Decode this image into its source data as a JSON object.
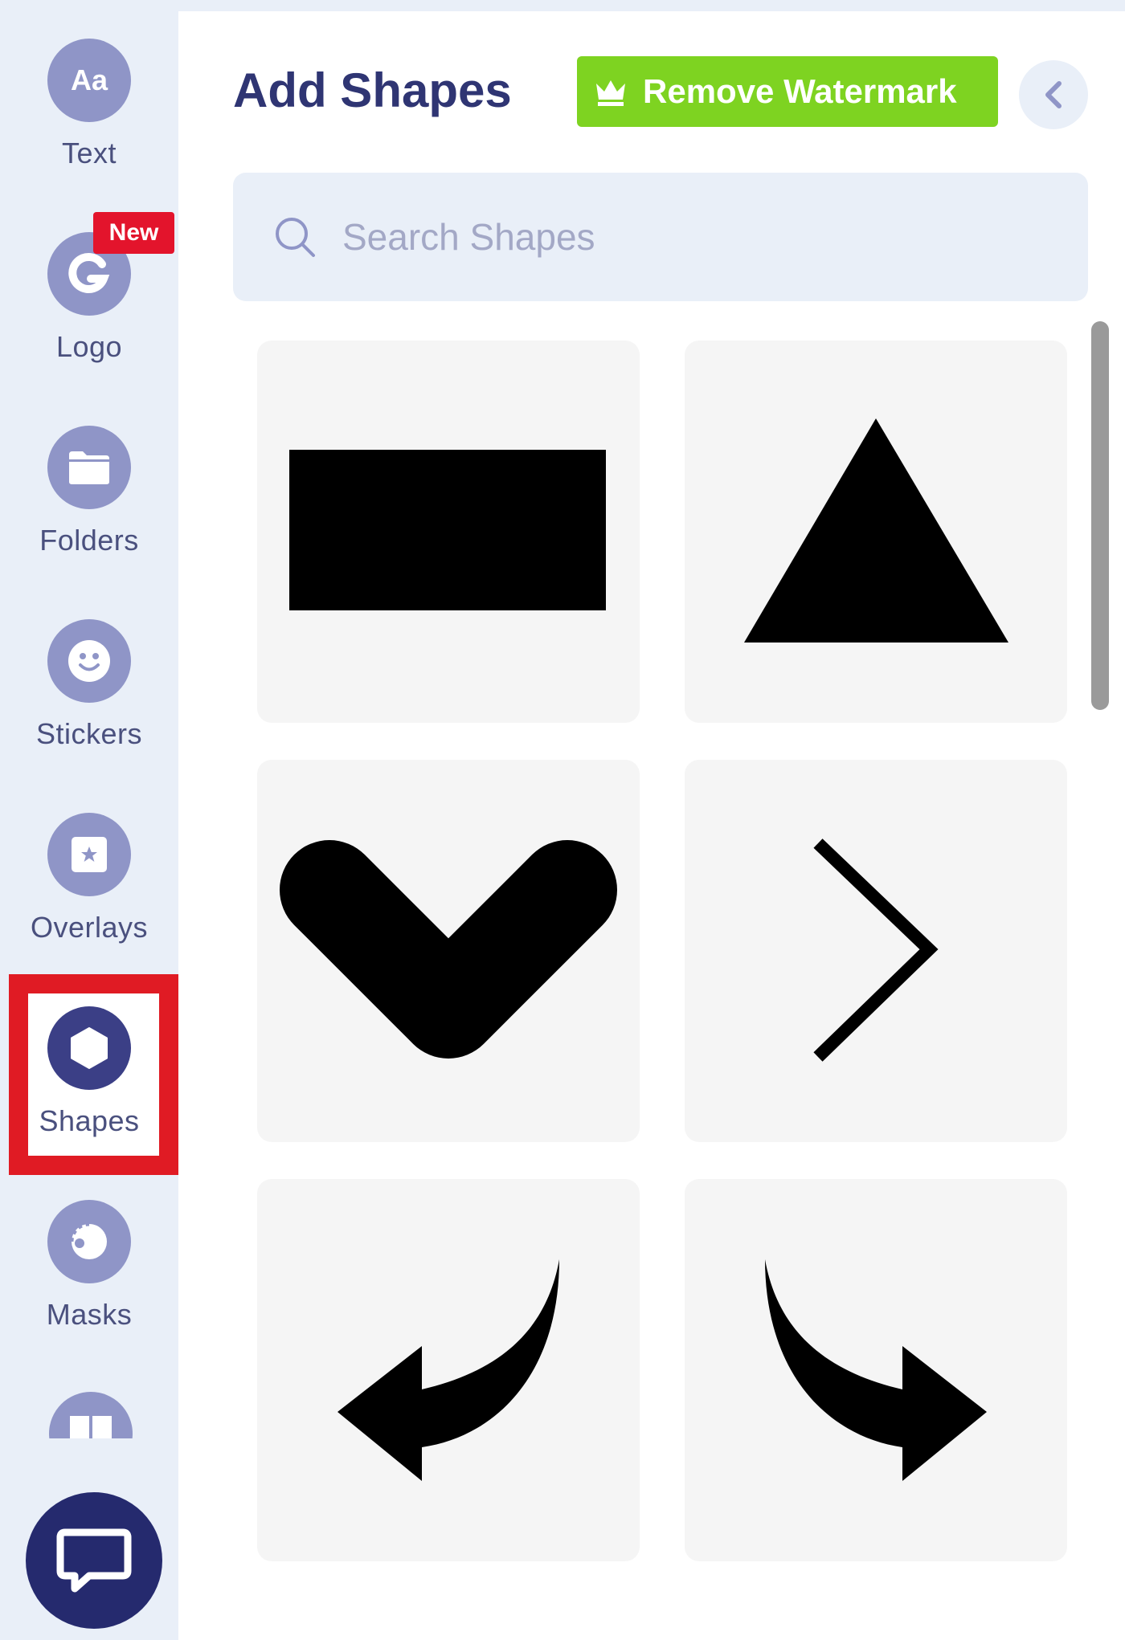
{
  "sidebar": {
    "items": [
      {
        "label": "Text",
        "icon": "text-aa-icon"
      },
      {
        "label": "Logo",
        "icon": "logo-icon",
        "badge": "New"
      },
      {
        "label": "Folders",
        "icon": "folder-icon"
      },
      {
        "label": "Stickers",
        "icon": "smiley-icon"
      },
      {
        "label": "Overlays",
        "icon": "star-frame-icon"
      },
      {
        "label": "Shapes",
        "icon": "hexagon-icon",
        "active": true
      },
      {
        "label": "Masks",
        "icon": "mask-icon"
      }
    ],
    "text_icon_glyph": "Aa",
    "chat_icon": "chat-bubble-icon"
  },
  "panel": {
    "title": "Add Shapes",
    "watermark_button": {
      "label": "Remove Watermark",
      "icon": "crown-icon",
      "color": "#7ed321"
    },
    "collapse_icon": "chevron-left-icon",
    "search": {
      "placeholder": "Search Shapes",
      "value": "",
      "icon": "search-icon"
    },
    "shapes": [
      {
        "name": "rectangle",
        "icon": "rectangle-shape-icon"
      },
      {
        "name": "triangle",
        "icon": "triangle-shape-icon"
      },
      {
        "name": "chevron-down",
        "icon": "chevron-down-shape-icon"
      },
      {
        "name": "chevron-right-thin",
        "icon": "chevron-right-shape-icon"
      },
      {
        "name": "curved-arrow-left",
        "icon": "curved-arrow-left-icon"
      },
      {
        "name": "curved-arrow-right",
        "icon": "curved-arrow-right-icon"
      }
    ]
  },
  "colors": {
    "sidebar_bg": "#e9eff8",
    "nav_circle": "#8f95c7",
    "nav_circle_active": "#3b3f86",
    "active_highlight": "#e01b24",
    "badge": "#e3142c",
    "title": "#2f3573",
    "chat_button": "#252a6e"
  }
}
